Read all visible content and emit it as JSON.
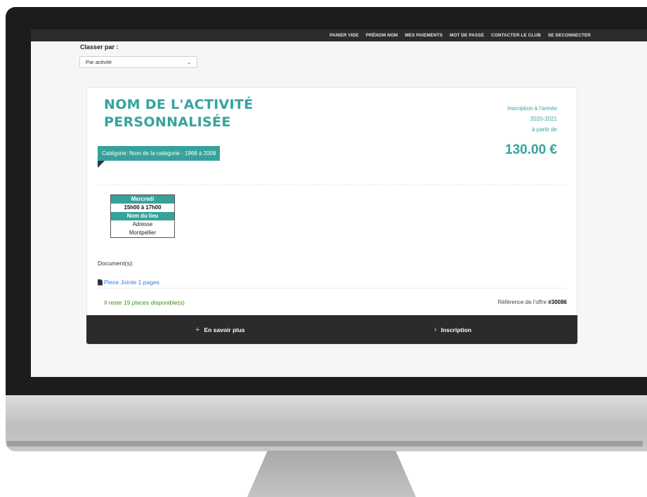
{
  "nav": {
    "items": [
      "PANIER VIDE",
      "PRÉNOM NOM",
      "MES PAIEMENTS",
      "MOT DE PASSE",
      "CONTACTER LE CLUB",
      "SE DECONNECTER"
    ]
  },
  "sort": {
    "label": "Classer par :",
    "selected": "Par activité"
  },
  "activity": {
    "title_line1": "NOM DE L'ACTIVITÉ",
    "title_line2": "PERSONNALISÉE",
    "category": "Catégorie: Nom de la catégorie - 1968 à 2008",
    "inscription_label": "Inscription à l'année",
    "season": "2020-2021",
    "from_label": "à partir de",
    "price": "130.00 €",
    "schedule": {
      "day": "Mercredi",
      "time": "15h00 à 17h00",
      "place": "Nom du lieu",
      "address": "Adresse",
      "city": "Montpellier"
    },
    "documents_label": "Document(s):",
    "document_link": "Piece Jointe 1.pages",
    "places_left": "Il reste 19 places disponible(s)",
    "reference_label": "Référence de l'offre",
    "reference_number": "#30086"
  },
  "actions": {
    "more_label": "En savoir plus",
    "more_icon": "plus-icon",
    "signup_label": "Inscription",
    "signup_icon": "chevron-right-icon"
  },
  "colors": {
    "accent": "#35a39c",
    "dark_bar": "#2b2b2b",
    "available": "#3f8f1c",
    "link": "#3b7dd8"
  }
}
